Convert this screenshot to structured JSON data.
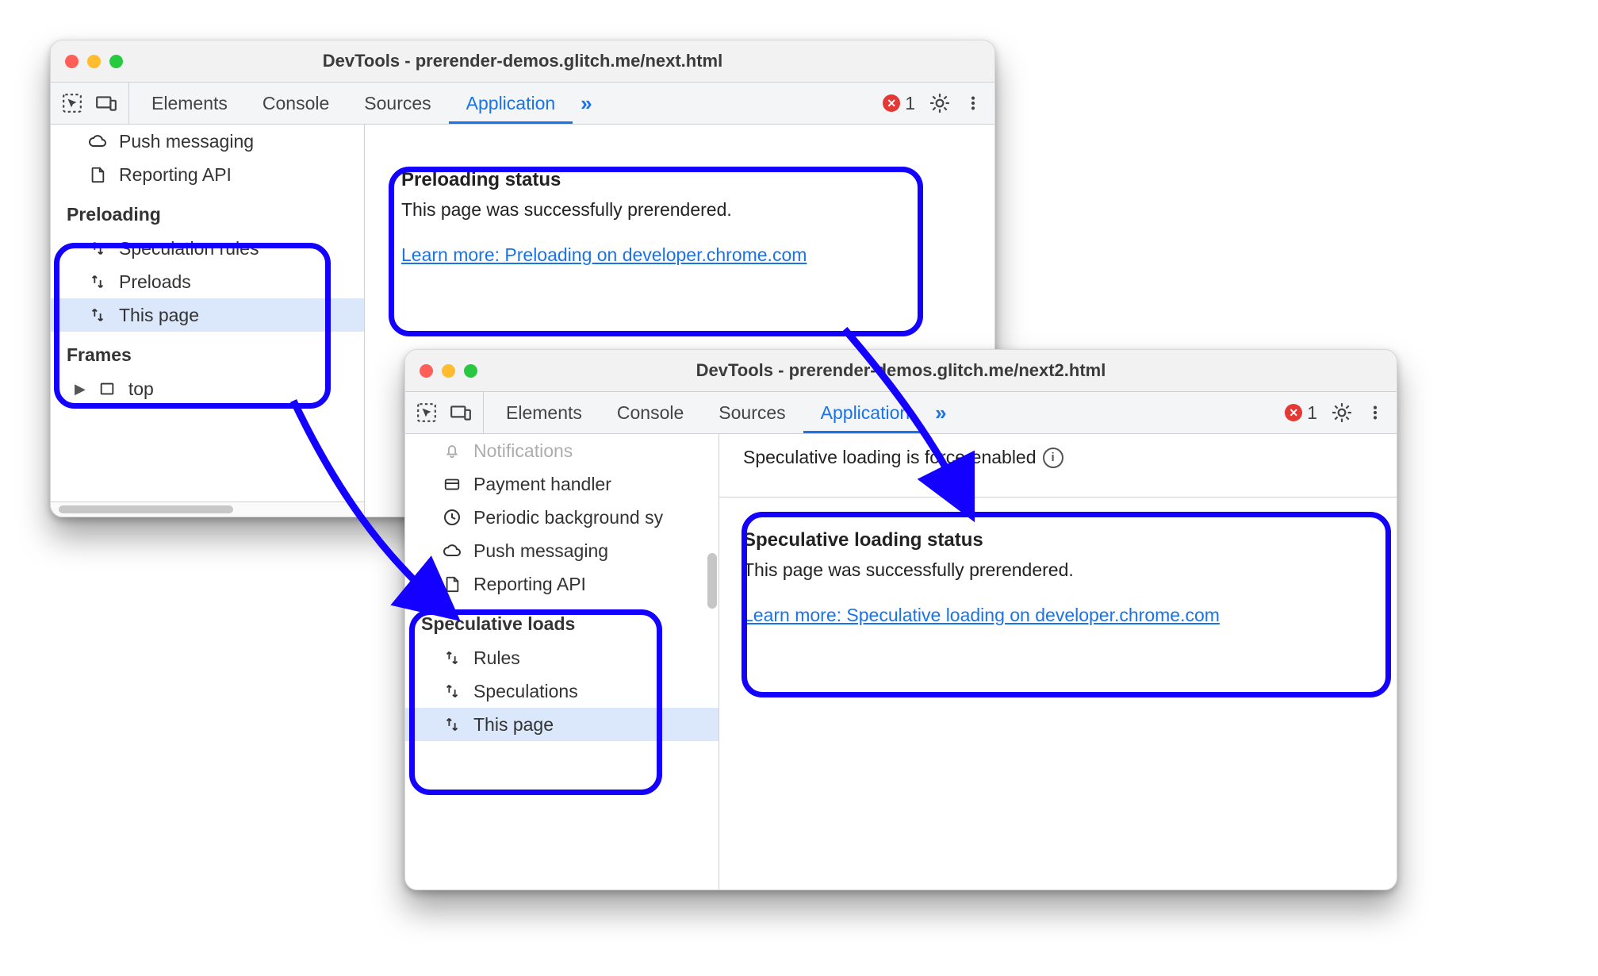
{
  "window1": {
    "title": "DevTools - prerender-demos.glitch.me/next.html",
    "tabs": [
      "Elements",
      "Console",
      "Sources",
      "Application"
    ],
    "active_tab": 3,
    "errors_count": "1",
    "sidebar_top": [
      {
        "icon": "cloud",
        "label": "Push messaging"
      },
      {
        "icon": "doc",
        "label": "Reporting API"
      }
    ],
    "preloading_section": {
      "title": "Preloading",
      "items": [
        "Speculation rules",
        "Preloads",
        "This page"
      ],
      "selected": 2
    },
    "frames_section": {
      "title": "Frames",
      "item": "top"
    },
    "panel": {
      "title": "Preloading status",
      "body": "This page was successfully prerendered.",
      "link": "Learn more: Preloading on developer.chrome.com"
    }
  },
  "window2": {
    "title": "DevTools - prerender-demos.glitch.me/next2.html",
    "tabs": [
      "Elements",
      "Console",
      "Sources",
      "Application"
    ],
    "active_tab": 3,
    "errors_count": "1",
    "sidebar_top": [
      {
        "icon": "bell",
        "label": "Notifications"
      },
      {
        "icon": "card",
        "label": "Payment handler"
      },
      {
        "icon": "clock",
        "label": "Periodic background sy"
      },
      {
        "icon": "cloud",
        "label": "Push messaging"
      },
      {
        "icon": "doc",
        "label": "Reporting API"
      }
    ],
    "spec_section": {
      "title": "Speculative loads",
      "items": [
        "Rules",
        "Speculations",
        "This page"
      ],
      "selected": 2
    },
    "banner": "Speculative loading is force-enabled",
    "panel": {
      "title": "Speculative loading status",
      "body": "This page was successfully prerendered.",
      "link": "Learn more: Speculative loading on developer.chrome.com"
    }
  }
}
